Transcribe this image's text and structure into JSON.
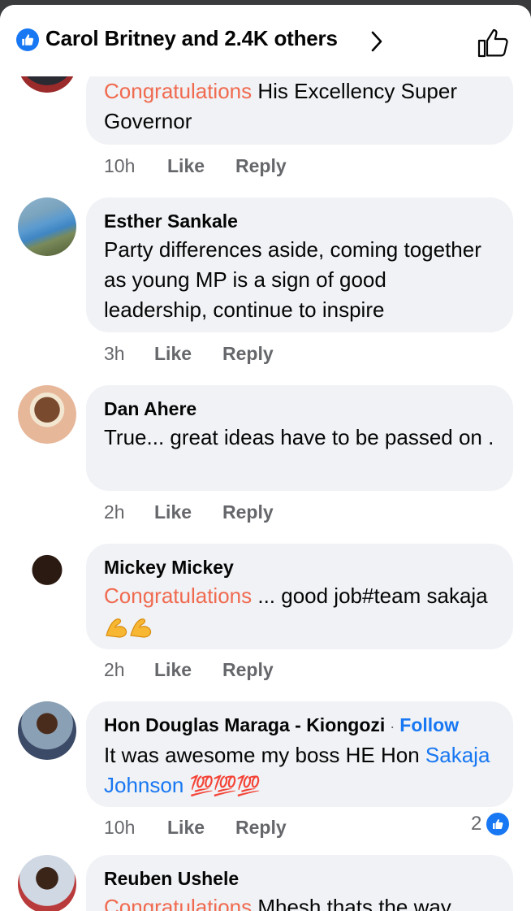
{
  "header": {
    "title": "Carol Britney and 2.4K others",
    "colors": {
      "like_blue": "#1877f2",
      "congrats": "#f06a4f"
    }
  },
  "comments": [
    {
      "author": "",
      "highlight": "Congratulations",
      "text": " His Excellency Super Governor",
      "time": "10h",
      "like": "Like",
      "reply": "Reply"
    },
    {
      "author": "Esther Sankale",
      "text": "Party differences aside, coming together as young MP is a sign of good leadership, continue to inspire",
      "time": "3h",
      "like": "Like",
      "reply": "Reply"
    },
    {
      "author": "Dan Ahere",
      "text": "True... great ideas have to be passed on .",
      "time": "2h",
      "like": "Like",
      "reply": "Reply"
    },
    {
      "author": "Mickey Mickey",
      "highlight": "Congratulations",
      "text": " ... good job#team sakaja",
      "emoji": "flexed-biceps-icon",
      "time": "2h",
      "like": "Like",
      "reply": "Reply"
    },
    {
      "author": "Hon Douglas Maraga - Kiongozi",
      "follow": "Follow",
      "text": "It was awesome my boss HE Hon ",
      "mention": "Sakaja Johnson",
      "emoji_text": "💯💯💯",
      "time": "10h",
      "like": "Like",
      "reply": "Reply",
      "reactions": "2"
    },
    {
      "author": "Reuben Ushele",
      "highlight": "Congratulations",
      "text": " Mhesh thats the way"
    }
  ]
}
